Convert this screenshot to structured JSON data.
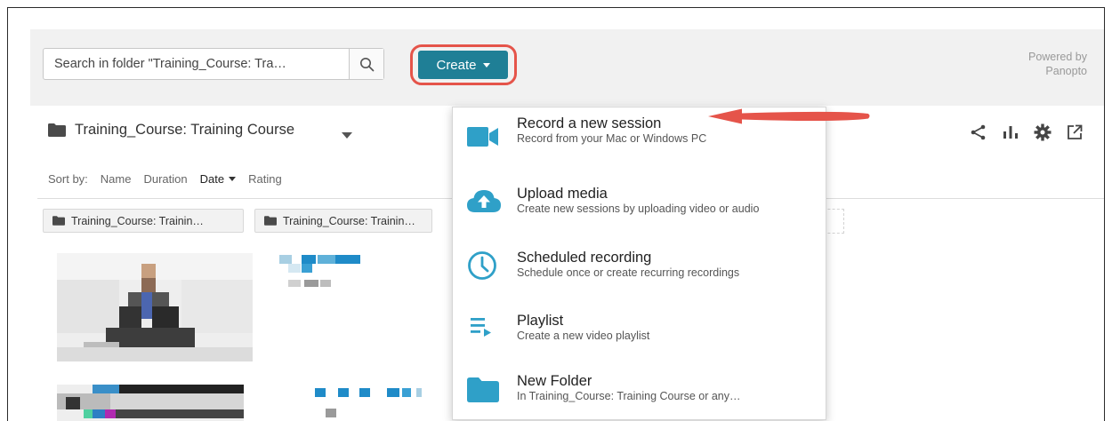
{
  "search": {
    "placeholder": "Search in folder \"Training_Course: Tra…"
  },
  "create": {
    "label": "Create"
  },
  "powered_by": {
    "line1": "Powered by",
    "line2": "Panopto"
  },
  "folder": {
    "title": "Training_Course: Training Course"
  },
  "sort": {
    "prefix": "Sort by:",
    "options": [
      "Name",
      "Duration",
      "Date",
      "Rating"
    ],
    "active": "Date"
  },
  "chips": [
    "Training_Course: Trainin…",
    "Training_Course: Trainin…"
  ],
  "menu": {
    "items": [
      {
        "label": "Record a new session",
        "sub": "Record from your Mac or Windows PC",
        "icon": "video-camera-icon"
      },
      {
        "label": "Upload media",
        "sub": "Create new sessions by uploading video or audio",
        "icon": "cloud-upload-icon"
      },
      {
        "label": "Scheduled recording",
        "sub": "Schedule once or create recurring recordings",
        "icon": "clock-icon"
      },
      {
        "label": "Playlist",
        "sub": "Create a new video playlist",
        "icon": "playlist-icon"
      },
      {
        "label": "New Folder",
        "sub": "In Training_Course: Training Course or any…",
        "icon": "folder-icon"
      }
    ]
  },
  "toolbar_icons": [
    "share-icon",
    "stats-icon",
    "settings-icon",
    "external-link-icon"
  ],
  "colors": {
    "accent": "#1f7f96",
    "icon_blue": "#2fa0c8",
    "highlight": "#e5544a"
  }
}
